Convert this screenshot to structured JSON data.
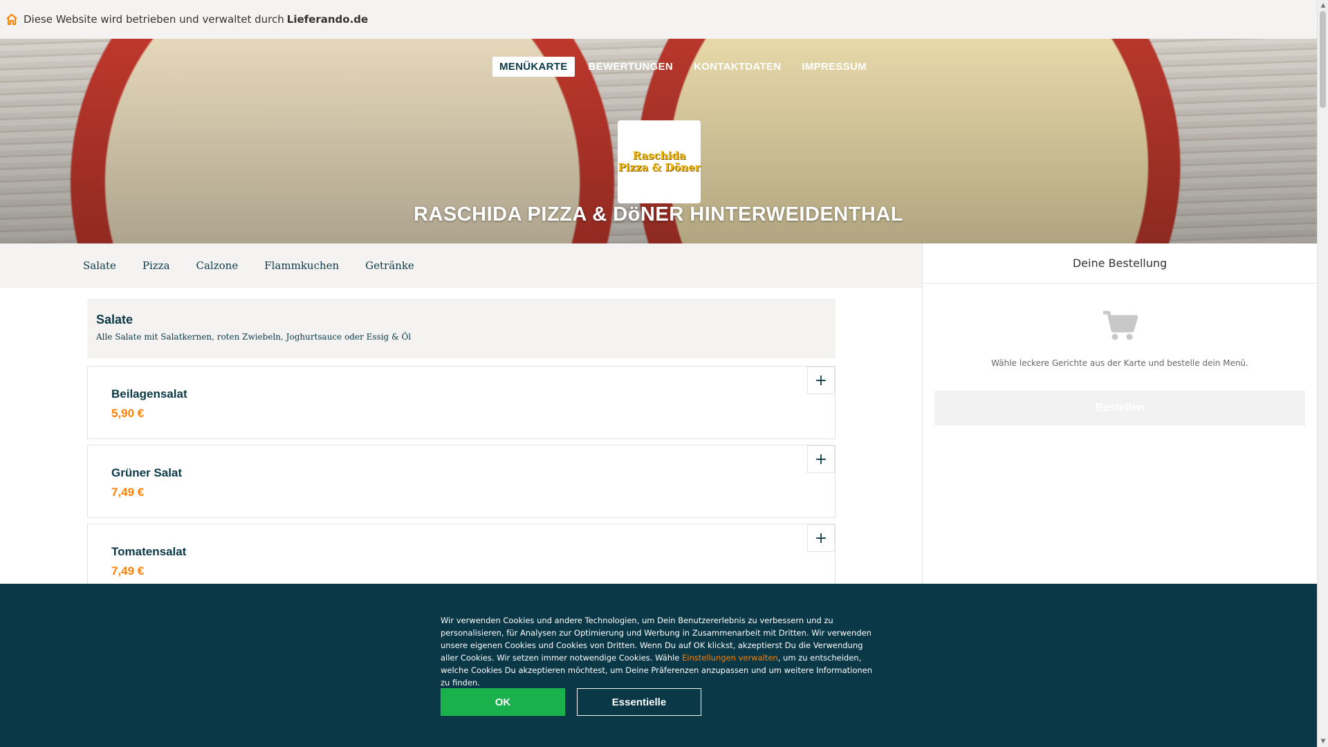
{
  "topbar": {
    "text": "Diese Website wird betrieben und verwaltet durch",
    "brand": "Lieferando.de",
    "icon": "home-icon",
    "icon_color": "#ff8000"
  },
  "hero": {
    "nav": [
      "MENÜKARTE",
      "BEWERTUNGEN",
      "KONTAKTDATEN",
      "IMPRESSUM"
    ],
    "logo_line1": "Raschida",
    "logo_line2": "Pizza & Döner",
    "title": "RASCHIDA PIZZA & DöNER HINTERWEIDENTHAL"
  },
  "categories": [
    "Salate",
    "Pizza",
    "Calzone",
    "Flammkuchen",
    "Getränke"
  ],
  "menu": {
    "section_title": "Salate",
    "section_description": "Alle Salate mit Salatkernen, roten Zwiebeln, Joghurtsauce oder Essig & Öl",
    "items": [
      {
        "name": "Beilagensalat",
        "price": "5,90 €"
      },
      {
        "name": "Grüner Salat",
        "price": "7,49 €"
      },
      {
        "name": "Tomatensalat",
        "price": "7,49 €"
      }
    ],
    "add_symbol": "+"
  },
  "basket": {
    "title": "Deine Bestellung",
    "empty_text": "Wähle leckere Gerichte aus der Karte und bestelle dein Menü.",
    "order_button": "Bestellen",
    "icon": "cart-icon"
  },
  "cookie": {
    "text_before": "Wir verwenden Cookies und andere Technologien, um Dein Benutzererlebnis zu verbessern und zu personalisieren, für Analysen zur Optimierung und Werbung in Zusammenarbeit mit Dritten. Wir verwenden unsere eigenen Cookies und Cookies von Dritten. Wenn Du auf OK klickst, akzeptierst Du die Verwendung aller Cookies. Wir setzen immer notwendige Cookies. Wähle ",
    "link": "Einstellungen verwalten",
    "text_after": ", um zu entscheiden, welche Cookies Du akzeptieren möchtest, um Deine Präferenzen anzupassen und um weitere Informationen zu finden.",
    "ok_button": "OK",
    "essential_button": "Essentielle"
  },
  "colors": {
    "accent": "#ff8000",
    "primary": "#0a3847",
    "ok_green": "#19b14b"
  }
}
